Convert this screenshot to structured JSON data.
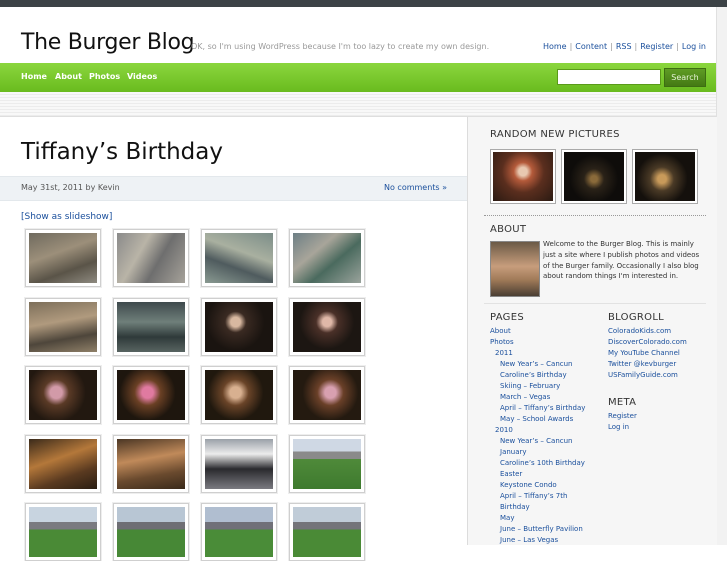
{
  "site": {
    "title": "The Burger Blog",
    "tagline": "OK, so I'm using WordPress because I'm too lazy to create my own design."
  },
  "top_links": [
    "Home",
    "Content",
    "RSS",
    "Register",
    "Log in"
  ],
  "nav": [
    "Home",
    "About",
    "Photos",
    "Videos"
  ],
  "search": {
    "button_label": "Search",
    "value": ""
  },
  "post": {
    "title": "Tiffany’s Birthday",
    "meta": "May 31st, 2011 by Kevin",
    "comments": "No comments »",
    "slideshow_link": "[Show as slideshow]"
  },
  "sidebar": {
    "random_heading": "RANDOM NEW PICTURES",
    "about_heading": "ABOUT",
    "about_text": "Welcome to the Burger Blog. This is mainly just a site where I publish photos and videos of the Burger family. Occasionally I also blog about random things I'm interested in.",
    "pages_heading": "PAGES",
    "pages": [
      "About",
      "Photos",
      "2011",
      "New Year’s – Cancun",
      "Caroline’s Birthday",
      "Skiing – February",
      "March – Vegas",
      "April – Tiffany’s Birthday",
      "May – School Awards",
      "2010",
      "New Year’s – Cancun",
      "January",
      "Caroline’s 10th Birthday",
      "Easter",
      "Keystone Condo",
      "April – Tiffany’s 7th",
      "Birthday",
      "May",
      "June – Butterfly Pavilion",
      "June – Las Vegas"
    ],
    "blogroll_heading": "BLOGROLL",
    "blogroll": [
      "ColoradoKids.com",
      "DiscoverColorado.com",
      "My YouTube Channel",
      "Twitter @kevburger",
      "USFamilyGuide.com"
    ],
    "meta_heading": "META",
    "meta": [
      "Register",
      "Log in"
    ]
  },
  "colors": {
    "nav_green": "#7ac72e",
    "link_blue": "#1a4f9c"
  }
}
